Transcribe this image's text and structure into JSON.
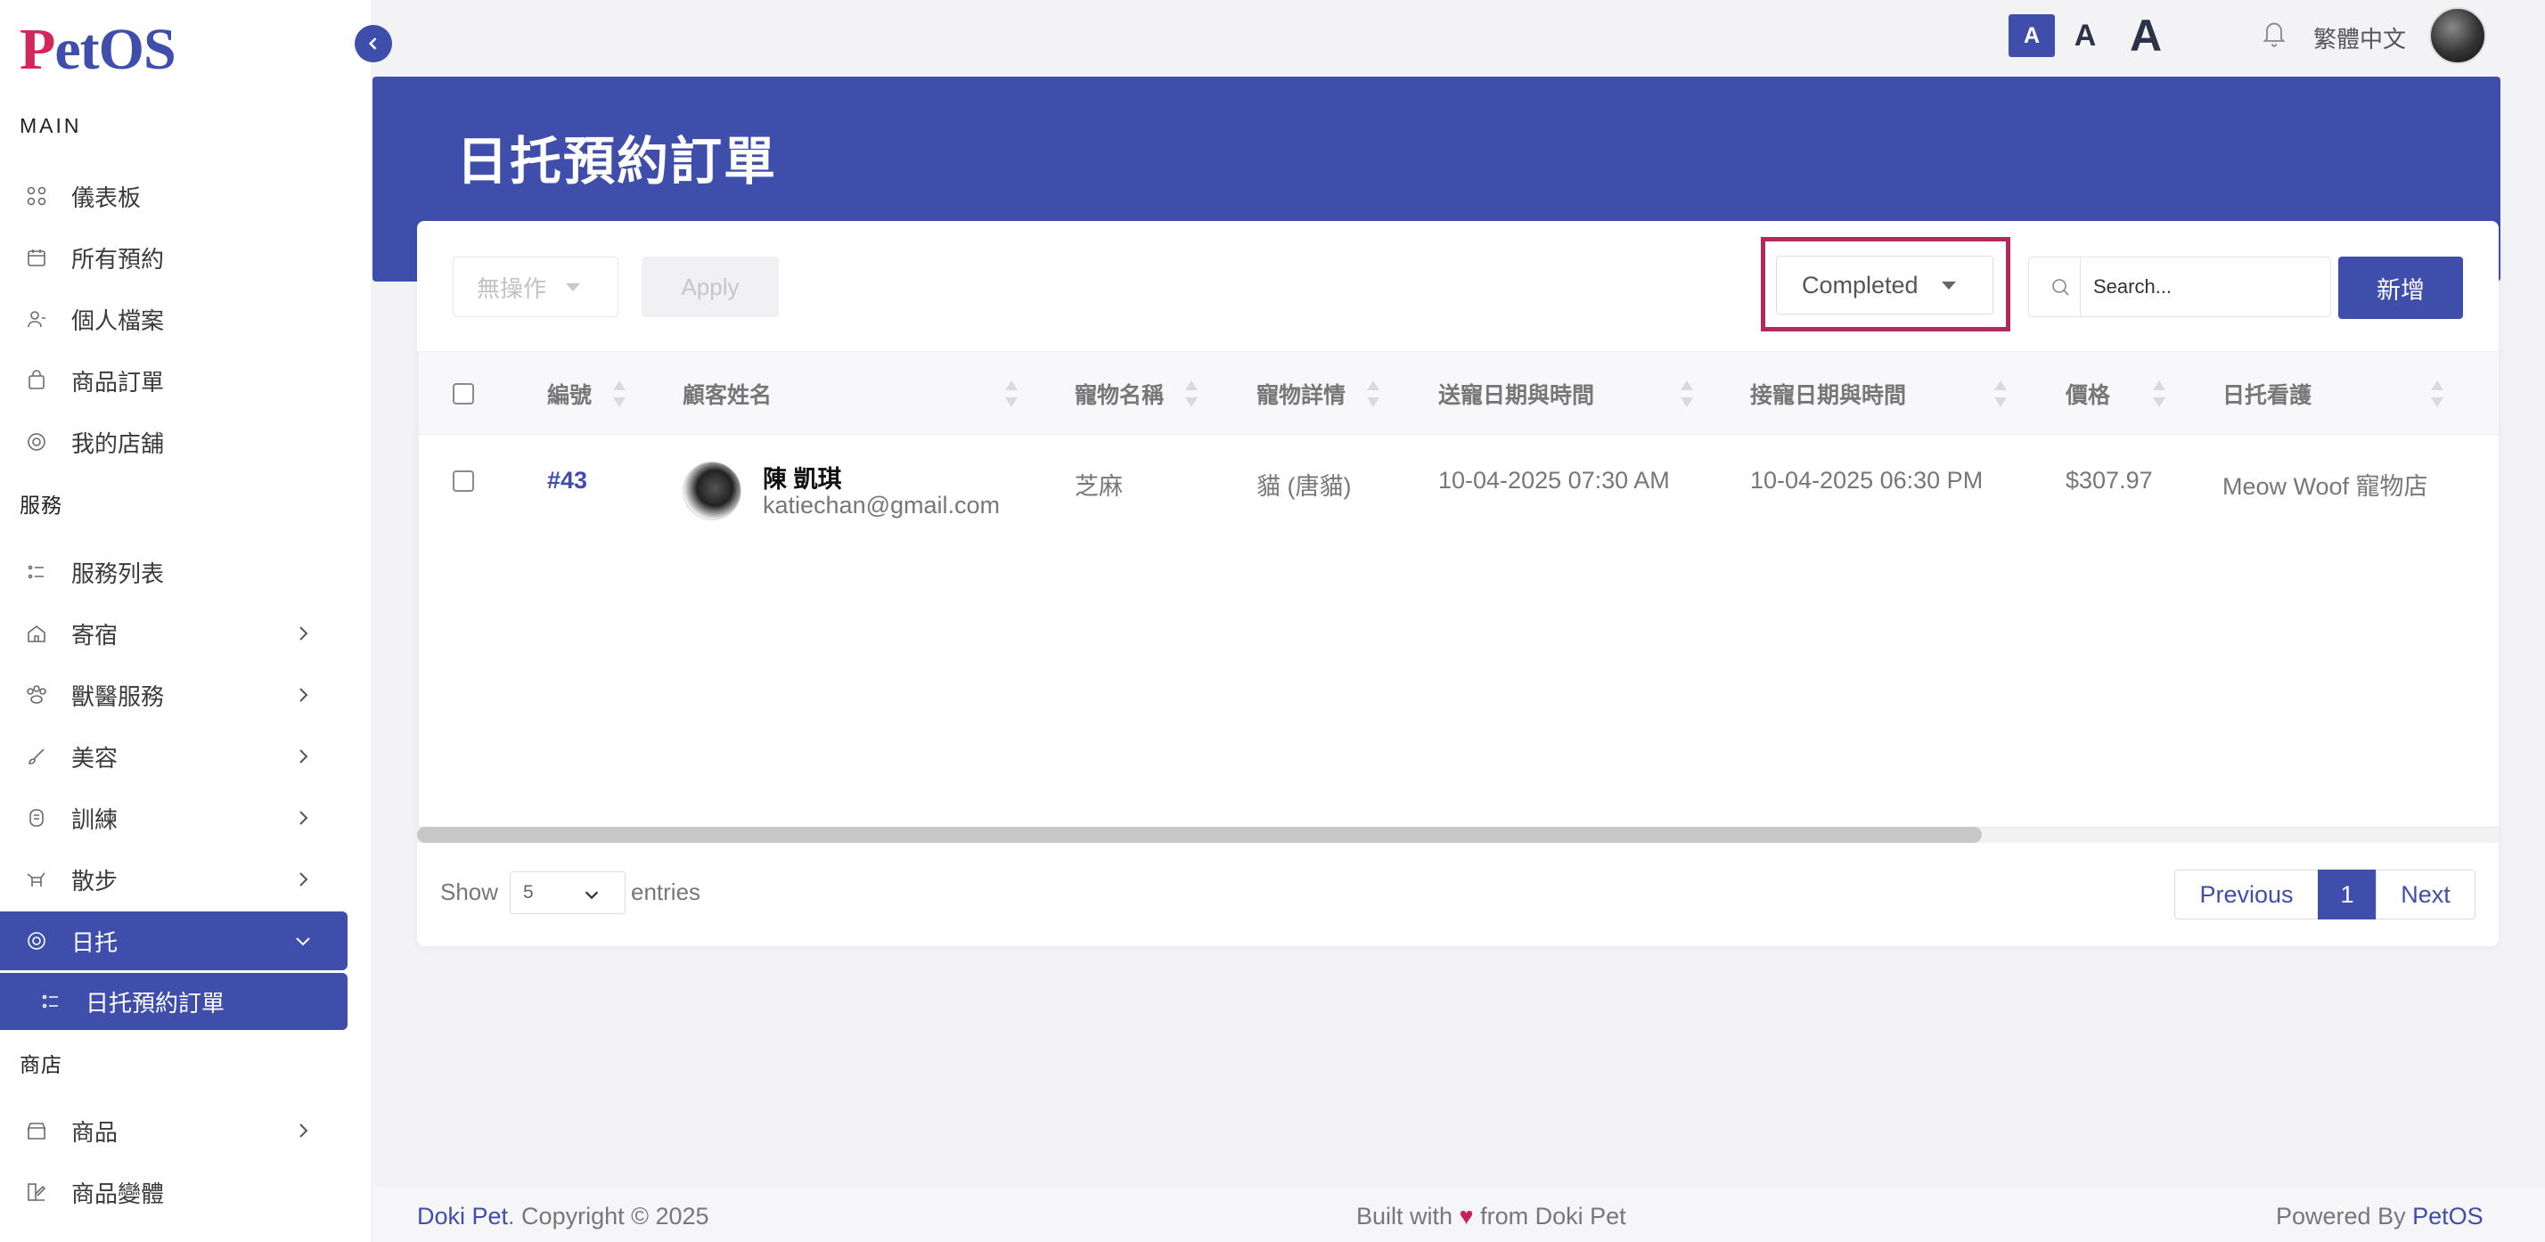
{
  "brand": {
    "logo_text_p": "P",
    "logo_text_rest": "etOS"
  },
  "sidebar": {
    "sections": {
      "main": "MAIN",
      "services": "服務",
      "shop": "商店"
    },
    "items": [
      {
        "label": "儀表板",
        "icon": "dashboard-icon"
      },
      {
        "label": "所有預約",
        "icon": "calendar-icon"
      },
      {
        "label": "個人檔案",
        "icon": "user-icon"
      },
      {
        "label": "商品訂單",
        "icon": "shopping-bag-icon"
      },
      {
        "label": "我的店舖",
        "icon": "paw-icon"
      },
      {
        "label": "服務列表",
        "icon": "list-icon"
      },
      {
        "label": "寄宿",
        "icon": "home-icon"
      },
      {
        "label": "獸醫服務",
        "icon": "paw-group-icon"
      },
      {
        "label": "美容",
        "icon": "brush-icon"
      },
      {
        "label": "訓練",
        "icon": "training-icon"
      },
      {
        "label": "散步",
        "icon": "dog-walk-icon"
      },
      {
        "label": "日托",
        "icon": "daycare-icon"
      },
      {
        "label": "日托預約訂單",
        "icon": "list-icon"
      },
      {
        "label": "商品",
        "icon": "store-icon"
      },
      {
        "label": "商品變體",
        "icon": "variant-icon"
      }
    ]
  },
  "topbar": {
    "font_small": "A",
    "font_medium": "A",
    "font_large": "A",
    "language": "繁體中文"
  },
  "page": {
    "title": "日托預約訂單"
  },
  "toolbar": {
    "bulk_action": "無操作",
    "apply": "Apply",
    "status_filter": "Completed",
    "search_placeholder": "Search...",
    "add": "新增"
  },
  "table": {
    "headers": [
      "編號",
      "顧客姓名",
      "寵物名稱",
      "寵物詳情",
      "送寵日期與時間",
      "接寵日期與時間",
      "價格",
      "日托看護"
    ],
    "rows": [
      {
        "id": "#43",
        "customer_name": "陳 凱琪",
        "customer_email": "katiechan@gmail.com",
        "pet_name": "芝麻",
        "pet_detail": "貓 (唐貓)",
        "dropoff": "10-04-2025 07:30 AM",
        "pickup": "10-04-2025 06:30 PM",
        "price": "$307.97",
        "caretaker": "Meow Woof 寵物店"
      }
    ]
  },
  "pagination": {
    "show": "Show",
    "entries_value": "5",
    "entries": "entries",
    "previous": "Previous",
    "current": "1",
    "next": "Next"
  },
  "footer": {
    "left_brand": "Doki Pet",
    "left_rest": ". Copyright © 2025",
    "mid_a": "Built with ",
    "mid_heart": "♥",
    "mid_b": " from Doki Pet",
    "right_a": "Powered By ",
    "right_brand": "PetOS"
  },
  "colors": {
    "primary": "#3f4eab",
    "logo_accent": "#d2275a",
    "highlight_border": "#b22a5a"
  }
}
